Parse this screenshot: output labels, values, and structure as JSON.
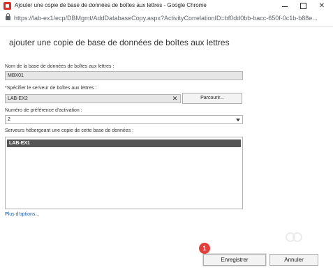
{
  "window": {
    "title": "Ajouter une copie de base de données de boîtes aux lettres - Google Chrome",
    "url": "https://lab-ex1/ecp/DBMgmt/AddDatabaseCopy.aspx?ActivityCorrelationID=bf0dd0bb-bacc-650f-0c1b-b88e..."
  },
  "dialog": {
    "title": "ajouter une copie de base de données de boîtes aux lettres",
    "db_name_label": "Nom de la base de données de boîtes aux lettres :",
    "db_name_value": "MBX01",
    "server_label": "*Spécifier le serveur de boîtes aux lettres :",
    "server_value": "LAB-EX2",
    "clear_glyph": "✕",
    "browse_label": "Parcourir...",
    "preference_label": "Numéro de préférence d'activation :",
    "preference_value": "2",
    "hosting_label": "Serveurs hébergeant une copie de cette base de données :",
    "hosting_servers": [
      "LAB-EX1"
    ],
    "more_options": "Plus d'options..."
  },
  "footer": {
    "step_badge": "1",
    "save_label": "Enregistrer",
    "cancel_label": "Annuler"
  },
  "icons": {
    "app": "chrome-app-icon",
    "lock": "lock-icon",
    "clear": "clear-icon",
    "dropdown": "chevron-down-icon"
  },
  "colors": {
    "selected_row": "#555555",
    "link": "#1a5aa0",
    "badge": "#e2403d"
  }
}
